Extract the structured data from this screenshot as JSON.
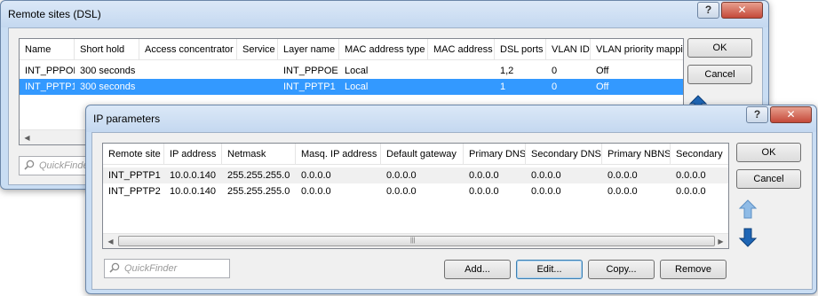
{
  "back_window": {
    "title": "Remote sites (DSL)",
    "help_btn": "?",
    "close_btn": "✕",
    "columns": [
      "Name",
      "Short hold",
      "Access concentrator",
      "Service",
      "Layer name",
      "MAC address type",
      "MAC address",
      "DSL ports",
      "VLAN ID",
      "VLAN priority mapping"
    ],
    "rows": [
      [
        "INT_PPPOE",
        "300 seconds",
        "",
        "",
        "INT_PPPOE",
        "Local",
        "",
        "1,2",
        "0",
        "Off"
      ],
      [
        "INT_PPTP1",
        "300 seconds",
        "",
        "",
        "INT_PPTP1",
        "Local",
        "",
        "1",
        "0",
        "Off"
      ]
    ],
    "ok_label": "OK",
    "cancel_label": "Cancel",
    "quickfinder_placeholder": "QuickFinder"
  },
  "front_window": {
    "title": "IP parameters",
    "help_btn": "?",
    "close_btn": "✕",
    "columns": [
      "Remote site",
      "IP address",
      "Netmask",
      "Masq. IP address",
      "Default gateway",
      "Primary DNS",
      "Secondary DNS",
      "Primary NBNS",
      "Secondary"
    ],
    "rows": [
      [
        "INT_PPTP1",
        "10.0.0.140",
        "255.255.255.0",
        "0.0.0.0",
        "0.0.0.0",
        "0.0.0.0",
        "0.0.0.0",
        "0.0.0.0",
        "0.0.0.0"
      ],
      [
        "INT_PPTP2",
        "10.0.0.140",
        "255.255.255.0",
        "0.0.0.0",
        "0.0.0.0",
        "0.0.0.0",
        "0.0.0.0",
        "0.0.0.0",
        "0.0.0.0"
      ]
    ],
    "ok_label": "OK",
    "cancel_label": "Cancel",
    "add_label": "Add...",
    "edit_label": "Edit...",
    "copy_label": "Copy...",
    "remove_label": "Remove",
    "quickfinder_placeholder": "QuickFinder"
  },
  "icons": {
    "search": "magnifier-icon",
    "up": "arrow-up-icon",
    "down": "arrow-down-icon"
  },
  "colors": {
    "selection": "#3399ff",
    "arrow_blue": "#1f66b5",
    "arrow_light": "#8fbbe6"
  }
}
